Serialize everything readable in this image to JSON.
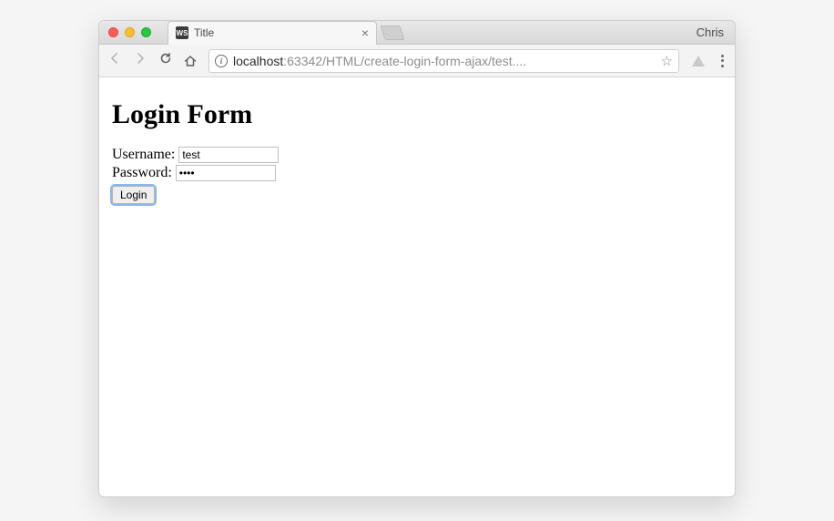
{
  "window": {
    "tab_title": "Title",
    "profile_name": "Chris"
  },
  "addressbar": {
    "host": "localhost",
    "rest": ":63342/HTML/create-login-form-ajax/test...."
  },
  "page": {
    "heading": "Login Form",
    "username_label": "Username:",
    "username_value": "test",
    "password_label": "Password:",
    "password_value": "••••",
    "login_button": "Login"
  }
}
